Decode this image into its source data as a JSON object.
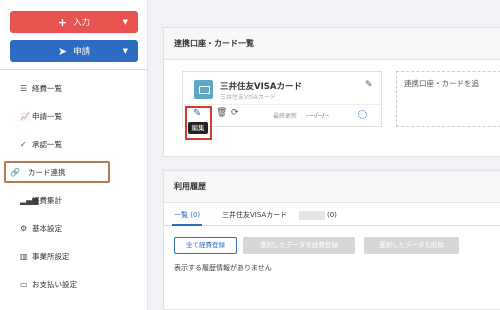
{
  "sidebar": {
    "input_button": "入力",
    "apply_button": "申請",
    "items": [
      {
        "label": "経費一覧",
        "icon": "list-icon"
      },
      {
        "label": "申請一覧",
        "icon": "chart-icon"
      },
      {
        "label": "承認一覧",
        "icon": "check-circle-icon"
      },
      {
        "label": "カード連携",
        "icon": "link-icon"
      },
      {
        "label": "経費集計",
        "icon": "bar-signal-icon"
      },
      {
        "label": "基本設定",
        "icon": "gear-icon"
      },
      {
        "label": "事業所設定",
        "icon": "building-icon"
      },
      {
        "label": "お支払い設定",
        "icon": "credit-card-icon"
      }
    ]
  },
  "linked": {
    "title": "連携口座・カード一覧",
    "card_name": "三井住友VISAカード",
    "card_sub": "三井住友VISAカード",
    "tooltip": "編集",
    "update_label": "最終更新",
    "update_value": "----/--/--",
    "add_text": "連携口座・カードを追"
  },
  "history": {
    "title": "利用履歴",
    "tab_all": "一覧 (0)",
    "tab_card": "三井住友VISAカード",
    "tab_card_count": "(0)",
    "btn_register_all": "全て経費登録",
    "btn_register_selected": "選択したデータを経費登録",
    "btn_delete_selected": "選択したデータを削除",
    "empty": "表示する履歴情報がありません"
  },
  "colors": {
    "accent": "#2d6cc2",
    "input": "#e8524f",
    "highlight": "#d43a2f"
  }
}
